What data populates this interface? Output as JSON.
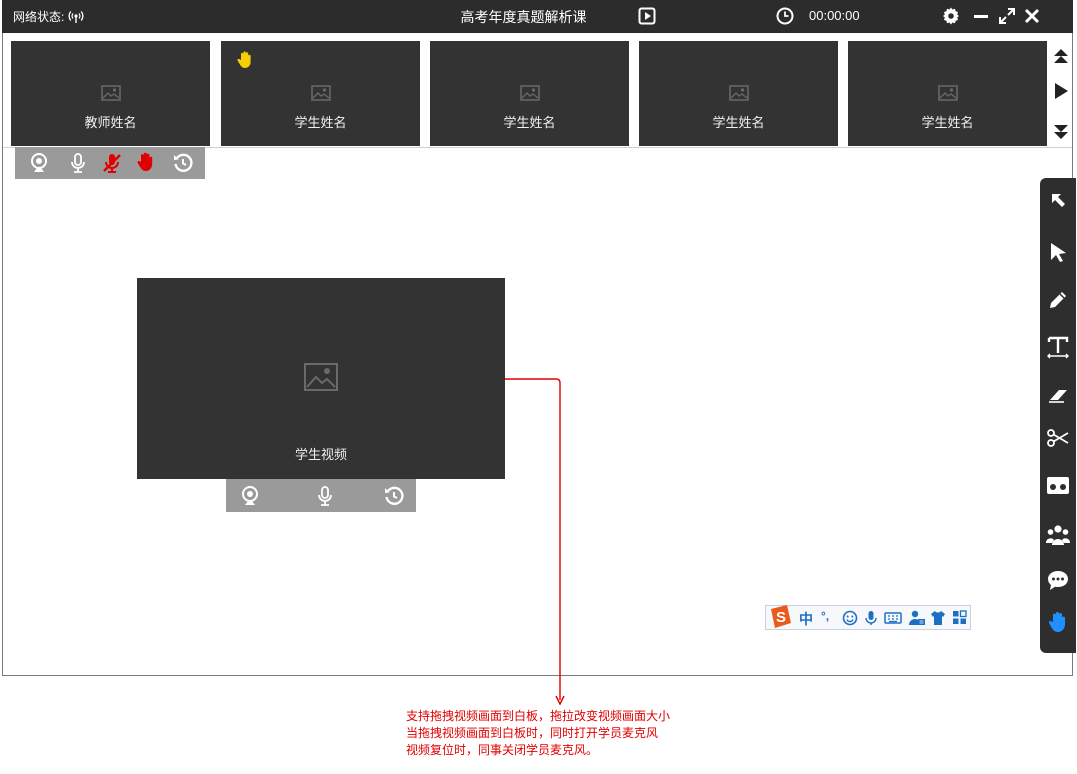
{
  "titlebar": {
    "network_label": "网络状态:",
    "title": "高考年度真题解析课",
    "time": "00:00:00",
    "icons": [
      "signal-icon",
      "play-icon",
      "clock-icon",
      "gear-icon",
      "minimize-icon",
      "maximize-icon",
      "close-icon"
    ]
  },
  "strip": {
    "tiles": [
      {
        "name": "教师姓名",
        "hand_raised": false
      },
      {
        "name": "学生姓名",
        "hand_raised": true
      },
      {
        "name": "学生姓名",
        "hand_raised": false
      },
      {
        "name": "学生姓名",
        "hand_raised": false
      },
      {
        "name": "学生姓名",
        "hand_raised": false
      }
    ],
    "nav": [
      "collapse-up-icon",
      "next-icon",
      "expand-down-icon"
    ]
  },
  "tile_controls": [
    "camera-icon",
    "mic-icon",
    "mic-off-icon",
    "hand-icon",
    "reset-icon"
  ],
  "video": {
    "name": "学生视频",
    "controls": [
      "camera-icon",
      "mic-icon",
      "reset-icon"
    ]
  },
  "toolbox": [
    "select-arrow-icon",
    "pointer-icon",
    "pencil-icon",
    "text-icon",
    "eraser-icon",
    "scissors-icon",
    "media-icon",
    "users-icon",
    "chat-icon",
    "raise-hand-icon"
  ],
  "ime": {
    "logo": "S",
    "items": [
      "中",
      "°,",
      "☺",
      "mic",
      "keyboard",
      "user",
      "shirt",
      "grid"
    ]
  },
  "annotation": {
    "lines": [
      "支持拖拽视频画面到白板，拖拉改变视频画面大小",
      "当拖拽视频画面到白板时，同时打开学员麦克风",
      "视频复位时，同事关闭学员麦克风。"
    ]
  },
  "colors": {
    "titlebar": "#2c2c2c",
    "tile": "#333333",
    "control_bar": "#9a9a9a",
    "alert_red": "#e00000",
    "hand_yellow": "#f5d000",
    "active_blue": "#1e90ff"
  }
}
